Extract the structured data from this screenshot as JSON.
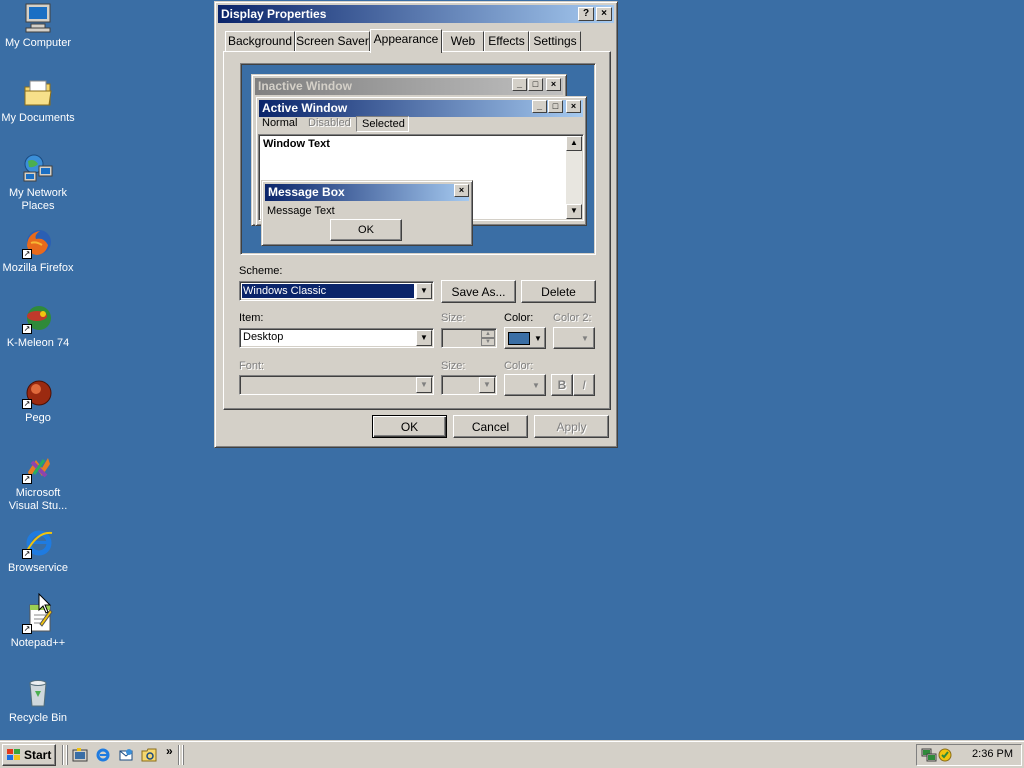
{
  "desktop": {
    "icons": [
      {
        "label": "My Computer"
      },
      {
        "label": "My Documents"
      },
      {
        "label": "My Network Places"
      },
      {
        "label": "Mozilla Firefox"
      },
      {
        "label": "K-Meleon 74"
      },
      {
        "label": "Pego"
      },
      {
        "label": "Microsoft Visual Stu..."
      },
      {
        "label": "Browservice"
      },
      {
        "label": "Notepad++"
      },
      {
        "label": "Recycle Bin"
      }
    ]
  },
  "dialog": {
    "title": "Display Properties",
    "help_button": "?",
    "close_button": "×",
    "tabs": [
      "Background",
      "Screen Saver",
      "Appearance",
      "Web",
      "Effects",
      "Settings"
    ],
    "active_tab": "Appearance",
    "preview": {
      "inactive_title": "Inactive Window",
      "active_title": "Active Window",
      "menu": [
        "Normal",
        "Disabled",
        "Selected"
      ],
      "window_text": "Window Text",
      "message_title": "Message Box",
      "message_text": "Message Text",
      "message_ok": "OK"
    },
    "scheme_label": "Scheme:",
    "scheme_value": "Windows Classic",
    "save_as": "Save As...",
    "delete": "Delete",
    "item_label": "Item:",
    "item_value": "Desktop",
    "size_label": "Size:",
    "color_label": "Color:",
    "color2_label": "Color 2:",
    "color_value": "#3a6ea5",
    "font_label": "Font:",
    "font_size_label": "Size:",
    "font_color_label": "Color:",
    "bold": "B",
    "italic": "I",
    "ok": "OK",
    "cancel": "Cancel",
    "apply": "Apply"
  },
  "taskbar": {
    "start": "Start",
    "chevron": "»",
    "clock": "2:36 PM"
  }
}
